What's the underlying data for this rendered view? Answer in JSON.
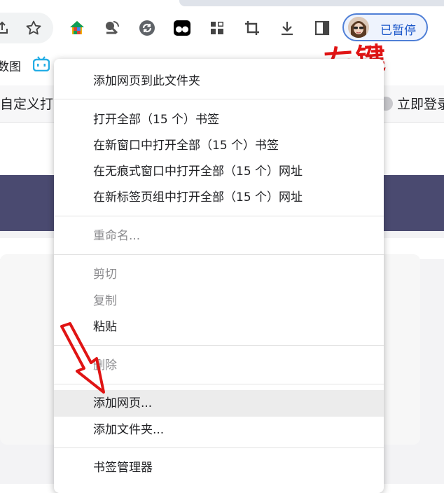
{
  "profile": {
    "status_label": "已暂停"
  },
  "toolbar": {
    "icons": [
      "share-icon",
      "star-icon",
      "home-icon",
      "satellite-icon",
      "sync-icon",
      "tampermonkey-icon",
      "extensions-grid-icon",
      "crop-icon",
      "download-icon",
      "side-panel-icon"
    ]
  },
  "bookmarks_bar": {
    "left_fragment": "数图"
  },
  "page": {
    "custom_bar_left": "自定义打",
    "login_label": "立即登录"
  },
  "annotation": {
    "text": "右键",
    "color": "#e01414"
  },
  "context_menu": {
    "items": [
      {
        "label": "添加网页到此文件夹",
        "enabled": true
      },
      {
        "label": "打开全部（15 个）书签",
        "enabled": true
      },
      {
        "label": "在新窗口中打开全部（15 个）书签",
        "enabled": true
      },
      {
        "label": "在无痕式窗口中打开全部（15 个）网址",
        "enabled": true
      },
      {
        "label": "在新标签页组中打开全部（15 个）网址",
        "enabled": true
      },
      {
        "label": "重命名...",
        "enabled": false
      },
      {
        "label": "剪切",
        "enabled": false
      },
      {
        "label": "复制",
        "enabled": false
      },
      {
        "label": "粘贴",
        "enabled": true
      },
      {
        "label": "删除",
        "enabled": false
      },
      {
        "label": "添加网页...",
        "enabled": true,
        "highlighted": true
      },
      {
        "label": "添加文件夹...",
        "enabled": true
      },
      {
        "label": "书签管理器",
        "enabled": true
      }
    ]
  }
}
